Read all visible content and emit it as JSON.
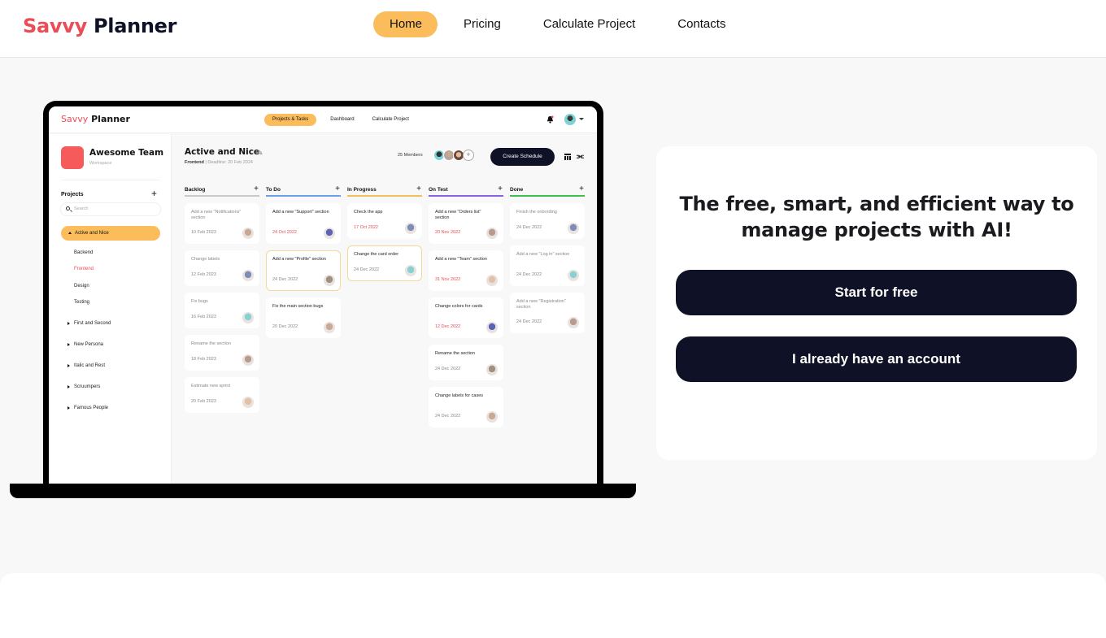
{
  "header": {
    "logo_accent": "Savvy",
    "logo_main": "Planner",
    "nav": [
      {
        "label": "Home",
        "active": true
      },
      {
        "label": "Pricing",
        "active": false
      },
      {
        "label": "Calculate Project",
        "active": false
      },
      {
        "label": "Contacts",
        "active": false
      }
    ]
  },
  "colors": {
    "brand_red": "#ec4c56",
    "accent_yellow": "#fbbd5c",
    "dark_navy": "#0f1226"
  },
  "preview": {
    "logo_accent": "Savvy",
    "logo_main": "Planner",
    "nav": [
      "Projects & Tasks",
      "Dashboard",
      "Calculate Project"
    ],
    "icons": {
      "notifications": "bell-icon",
      "profile": "avatar",
      "menu": "caret-down-icon"
    },
    "sidebar": {
      "team_name": "Awesome Team",
      "team_sub": "Workspace",
      "projects_label": "Projects",
      "search_placeholder": "Search",
      "active_project": "Active and Nice",
      "subitems": [
        "Backend",
        "Frontend",
        "Design",
        "Testing"
      ],
      "selected_subitem": "Frontend",
      "projects": [
        "First and Second",
        "New Persona",
        "Italic and Rest",
        "Scruumpers",
        "Famous People"
      ]
    },
    "main": {
      "title": "Active and Nice",
      "sub_bold": "Frontend",
      "sub_rest": " | Deadline: 20 Feb 2024",
      "members": "25 Members",
      "create_label": "Create Schedule",
      "columns": [
        {
          "name": "Backlog",
          "color": "#c9c9c9",
          "cards": [
            {
              "title": "Add a new \"Notifications\" section",
              "date": "10 Feb 2023",
              "muted": true,
              "overdue": false
            },
            {
              "title": "Change labels",
              "date": "12 Feb 2023",
              "muted": true,
              "overdue": false
            },
            {
              "title": "Fix bugs",
              "date": "16 Feb 2023",
              "muted": true,
              "overdue": false
            },
            {
              "title": "Rename the section",
              "date": "18 Feb 2023",
              "muted": true,
              "overdue": false
            },
            {
              "title": "Estimate new sprint",
              "date": "20 Feb 2023",
              "muted": true,
              "overdue": false
            }
          ]
        },
        {
          "name": "To Do",
          "color": "#6d9eea",
          "cards": [
            {
              "title": "Add a new \"Support\" section",
              "date": "24 Oct 2022",
              "muted": false,
              "overdue": true
            },
            {
              "title": "Add a new \"Profile\" section",
              "date": "24 Dec 2022",
              "muted": false,
              "overdue": false,
              "highlight": true
            },
            {
              "title": "Fix the main section bugs",
              "date": "20 Dec 2022",
              "muted": false,
              "overdue": false
            }
          ]
        },
        {
          "name": "In Progress",
          "color": "#f2c05a",
          "cards": [
            {
              "title": "Check the app",
              "date": "17 Oct 2022",
              "muted": false,
              "overdue": true
            },
            {
              "title": "Change the card order",
              "date": "24 Dec 2022",
              "muted": false,
              "overdue": false,
              "highlight": true
            }
          ]
        },
        {
          "name": "On Test",
          "color": "#8a63e0",
          "cards": [
            {
              "title": "Add a new \"Orders list\" section",
              "date": "20 Nov 2022",
              "muted": false,
              "overdue": true
            },
            {
              "title": "Add a new \"Team\" section",
              "date": "31 Nov 2022",
              "muted": false,
              "overdue": true
            },
            {
              "title": "Change colors for cards",
              "date": "12 Dec 2022",
              "muted": false,
              "overdue": true
            },
            {
              "title": "Rename the section",
              "date": "24 Dec 2022",
              "muted": false,
              "overdue": false
            },
            {
              "title": "Change labels for cases",
              "date": "24 Dec 2022",
              "muted": false,
              "overdue": false
            }
          ]
        },
        {
          "name": "Done",
          "color": "#3fbf4f",
          "cards": [
            {
              "title": "Finish the onbording",
              "date": "24 Dec 2022",
              "muted": true,
              "overdue": false
            },
            {
              "title": "Add a new \"Log in\" section",
              "date": "24 Dec 2022",
              "muted": true,
              "overdue": false
            },
            {
              "title": "Add a new \"Registration\" section",
              "date": "24 Dec 2022",
              "muted": true,
              "overdue": false
            }
          ]
        }
      ]
    }
  },
  "hero": {
    "headline": "The free, smart, and efficient way to manage projects with AI!",
    "primary_cta": "Start for free",
    "secondary_cta": "I already have an account"
  }
}
